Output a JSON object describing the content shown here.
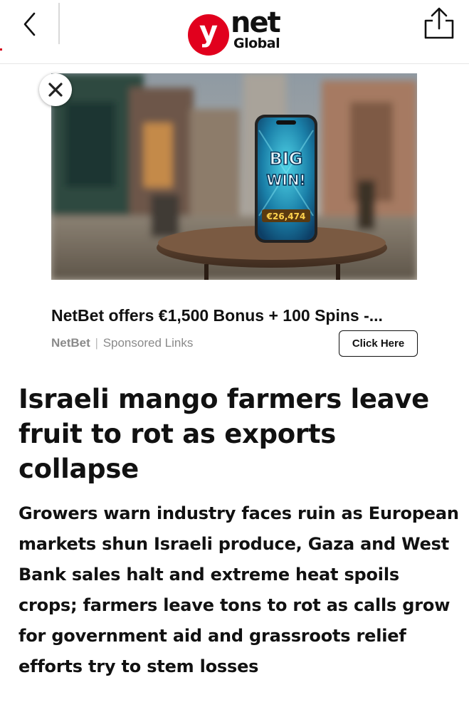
{
  "header": {
    "logo_letter": "y",
    "logo_net": "net",
    "logo_global": "Global",
    "back_icon": "chevron-left-icon",
    "share_icon": "share-icon",
    "accent_color": "#e1001d"
  },
  "ad": {
    "image_text_big": "BIG",
    "image_text_win": "WIN!",
    "image_amount": "€26,474",
    "title": "NetBet offers €1,500 Bonus + 100 Spins -...",
    "brand": "NetBet",
    "separator": "|",
    "sponsored": "Sponsored Links",
    "cta": "Click Here",
    "close_icon": "close-icon"
  },
  "article": {
    "headline": "Israeli mango farmers leave fruit to rot as exports collapse",
    "subhead": "Growers warn industry faces ruin as European markets shun Israeli produce, Gaza and West Bank sales halt and extreme heat spoils crops; farmers leave tons to rot as calls grow for government aid and grassroots relief efforts try to stem losses"
  }
}
